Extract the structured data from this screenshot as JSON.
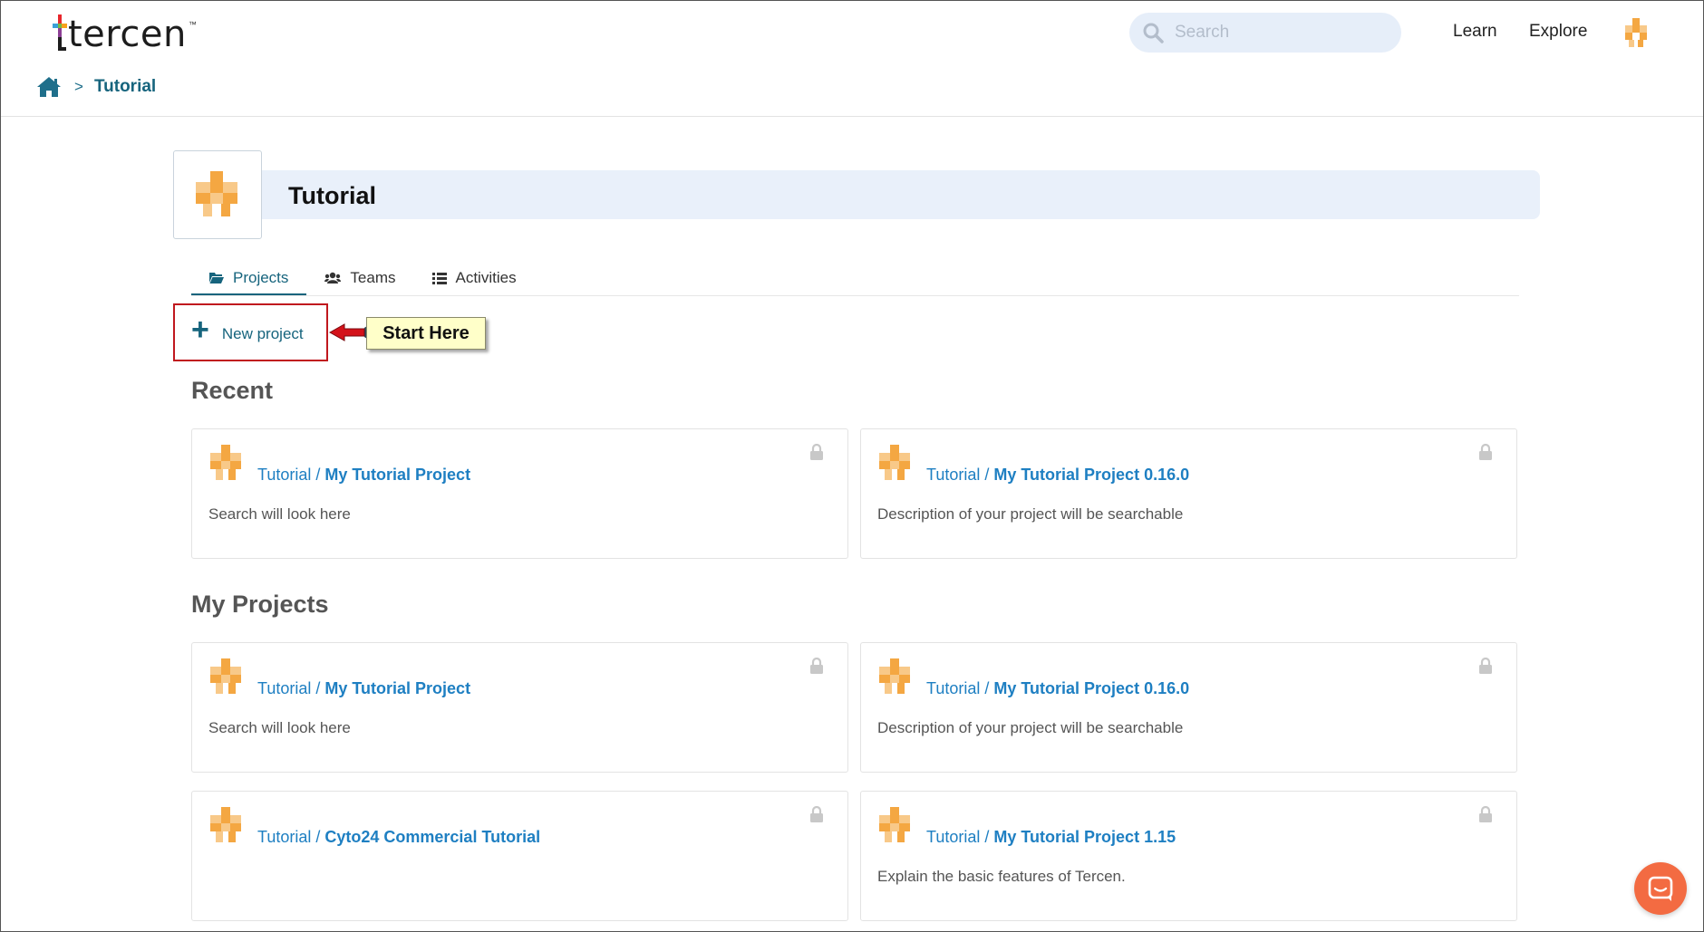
{
  "app": {
    "name": "tercen",
    "trademark": "™"
  },
  "header": {
    "search_placeholder": "Search",
    "nav": {
      "learn": "Learn",
      "explore": "Explore"
    }
  },
  "breadcrumb": {
    "separator": ">",
    "current": "Tutorial"
  },
  "team": {
    "name": "Tutorial"
  },
  "tabs": [
    {
      "label": "Projects",
      "icon": "folder-open-icon",
      "active": true
    },
    {
      "label": "Teams",
      "icon": "users-icon",
      "active": false
    },
    {
      "label": "Activities",
      "icon": "list-icon",
      "active": false
    }
  ],
  "actions": {
    "new_project": "New project",
    "callout": "Start Here"
  },
  "recent": {
    "title": "Recent",
    "cards": [
      {
        "owner": "Tutorial",
        "sep": " / ",
        "name": "My Tutorial Project",
        "description": "Search will look here"
      },
      {
        "owner": "Tutorial",
        "sep": " / ",
        "name": "My Tutorial Project 0.16.0",
        "description": "Description of your project will be searchable"
      }
    ]
  },
  "my_projects": {
    "title": "My Projects",
    "cards": [
      {
        "owner": "Tutorial",
        "sep": " / ",
        "name": "My Tutorial Project",
        "description": "Search will look here"
      },
      {
        "owner": "Tutorial",
        "sep": " / ",
        "name": "My Tutorial Project 0.16.0",
        "description": "Description of your project will be searchable"
      },
      {
        "owner": "Tutorial",
        "sep": " / ",
        "name": "Cyto24 Commercial Tutorial",
        "description": ""
      },
      {
        "owner": "Tutorial",
        "sep": " / ",
        "name": "My Tutorial Project 1.15",
        "description": "Explain the basic features of Tercen."
      }
    ]
  },
  "colors": {
    "accent": "#16647d",
    "link": "#1e7fc2",
    "avatar_orange": "#f4a742",
    "avatar_orange_light": "#f8c989",
    "callout_bg": "#ffffc9",
    "highlight_red": "#c0181e",
    "chat": "#f36b42"
  }
}
